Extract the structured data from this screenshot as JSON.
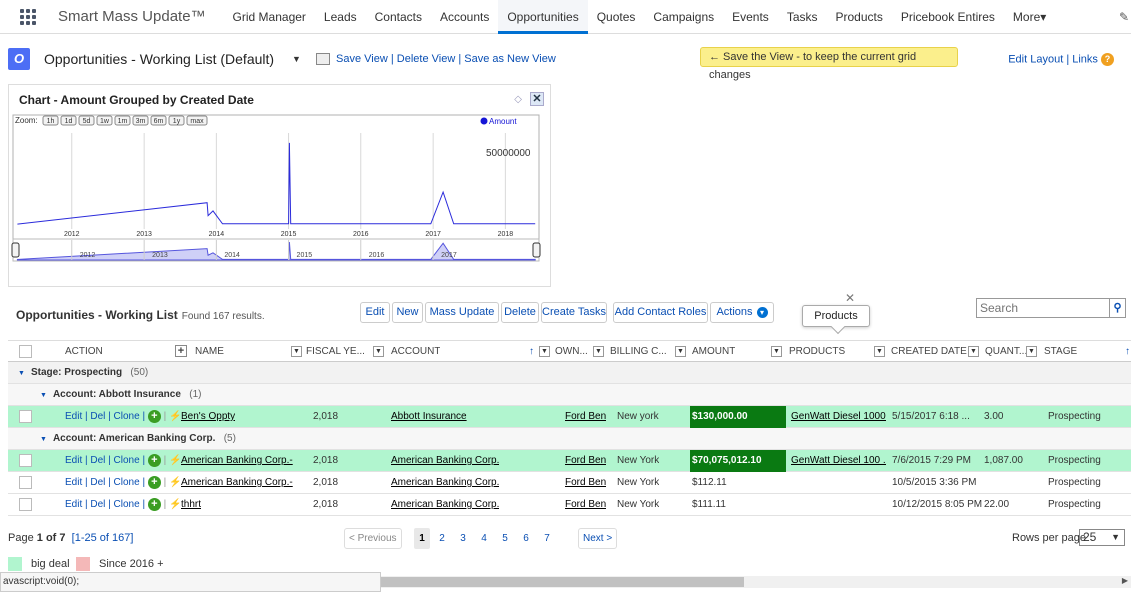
{
  "app": {
    "title": "Smart Mass Update™"
  },
  "nav": {
    "tabs": [
      "Grid Manager",
      "Leads",
      "Contacts",
      "Accounts",
      "Opportunities",
      "Quotes",
      "Campaigns",
      "Events",
      "Tasks",
      "Products",
      "Pricebook Entires",
      "More▾"
    ],
    "active": "Opportunities"
  },
  "view": {
    "icon_letter": "O",
    "name": "Opportunities - Working List (Default)",
    "links": [
      "Save View",
      "Delete View",
      "Save as New View"
    ],
    "save_hint": "← Save the View - to keep the current grid changes",
    "edit_layout": "Edit Layout",
    "links_label": "Links"
  },
  "chart": {
    "title": "Chart - Amount Grouped by Created Date",
    "zoom_label": "Zoom:",
    "zoom_options": [
      "1h",
      "1d",
      "5d",
      "1w",
      "1m",
      "3m",
      "6m",
      "1y",
      "max"
    ],
    "legend": "Amount",
    "y_tick": "50000000",
    "x_ticks": [
      "2012",
      "2013",
      "2014",
      "2015",
      "2016",
      "2017",
      "2018"
    ],
    "nav_ticks": [
      "2012",
      "2013",
      "2014",
      "2015",
      "2016",
      "2017"
    ]
  },
  "chart_data": {
    "type": "line",
    "title": "Chart - Amount Grouped by Created Date",
    "series": [
      {
        "name": "Amount",
        "x": [
          "2011-04-01",
          "2011-06-01",
          "2013-11-15",
          "2013-11-20",
          "2013-12-15",
          "2014-02-01",
          "2015-01-01",
          "2015-01-05",
          "2015-01-12",
          "2015-02-01",
          "2016-12-20",
          "2017-02-20",
          "2017-04-15",
          "2018-06-01"
        ],
        "y": [
          800000,
          2000000,
          19000000,
          8000000,
          12000000,
          1000000,
          1000000,
          70000000,
          1000000,
          1000000,
          1000000,
          28000000,
          1000000,
          1000000
        ]
      }
    ],
    "x_ticks": [
      "2012",
      "2013",
      "2014",
      "2015",
      "2016",
      "2017",
      "2018"
    ],
    "y_ticks": [
      "50000000"
    ]
  },
  "grid": {
    "title": "Opportunities - Working List",
    "found": "Found 167 results.",
    "buttons": [
      "Edit",
      "New",
      "Mass Update",
      "Delete",
      "Create Tasks",
      "Add Contact Roles",
      "Actions"
    ],
    "popover": "Products",
    "search_placeholder": "Search",
    "columns": [
      "ACTION",
      "NAME",
      "FISCAL YE...",
      "ACCOUNT",
      "OWN...",
      "BILLING C...",
      "AMOUNT",
      "PRODUCTS",
      "CREATED DATE",
      "QUANT...",
      "STAGE"
    ],
    "actions_text": "Edit | Del | Clone |",
    "group_stage": "Stage: Prospecting",
    "group_stage_count": "(50)",
    "group_acct1": "Account: Abbott Insurance",
    "group_acct1_count": "(1)",
    "group_acct2": "Account: American Banking Corp.",
    "group_acct2_count": "(5)",
    "rows": [
      {
        "name": "Ben's Oppty",
        "fiscal": "2,018",
        "account": "Abbott Insurance",
        "owner": "Ford Ben",
        "billing": "New york",
        "amount": "$130,000.00",
        "products": "GenWatt Diesel 1000 ...",
        "created": "5/15/2017 6:18 ...",
        "qty": "3.00",
        "stage": "Prospecting"
      },
      {
        "name": "American Banking Corp.-",
        "fiscal": "2,018",
        "account": "American Banking Corp.",
        "owner": "Ford Ben",
        "billing": "New York",
        "amount": "$70,075,012.10",
        "products": "GenWatt Diesel 100 ...",
        "created": "7/6/2015 7:29 PM",
        "qty": "1,087.00",
        "stage": "Prospecting"
      },
      {
        "name": "American Banking Corp.-",
        "fiscal": "2,018",
        "account": "American Banking Corp.",
        "owner": "Ford Ben",
        "billing": "New York",
        "amount": "$112.11",
        "products": "",
        "created": "10/5/2015 3:36 PM",
        "qty": "",
        "stage": "Prospecting"
      },
      {
        "name": "thhrt",
        "fiscal": "2,018",
        "account": "American Banking Corp.",
        "owner": "Ford Ben",
        "billing": "New York",
        "amount": "$111.11",
        "products": "",
        "created": "10/12/2015 8:05 PM",
        "qty": "22.00",
        "stage": "Prospecting"
      }
    ]
  },
  "pager": {
    "page_label": "Page",
    "page_current": "1",
    "page_of": "of 7",
    "range": "[1-25 of 167]",
    "prev": "< Previous",
    "pages": [
      "1",
      "2",
      "3",
      "4",
      "5",
      "6",
      "7"
    ],
    "next": "Next >",
    "rows_label": "Rows per page",
    "rows_value": "25"
  },
  "legend": {
    "items": [
      {
        "label": "big deal",
        "color": "#b1f5cf"
      },
      {
        "label": "Since 2016 +",
        "color": "#f4b8b8"
      }
    ]
  },
  "status": {
    "text": "avascript:void(0);"
  },
  "colors": {
    "accent": "#0070d2",
    "highlight_row": "#b1f5cf",
    "amount_dark": "#0a7a12",
    "chart_line": "#2b2bdb"
  }
}
